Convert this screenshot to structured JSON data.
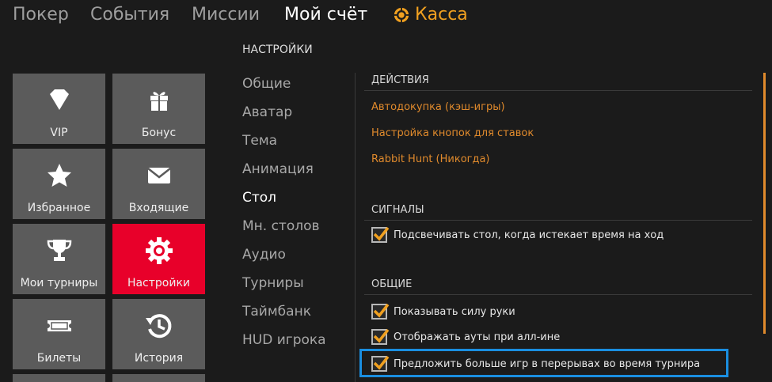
{
  "nav": {
    "items": [
      {
        "label": "Покер",
        "active": false
      },
      {
        "label": "События",
        "active": false
      },
      {
        "label": "Миссии",
        "active": false
      },
      {
        "label": "Мой счёт",
        "active": true
      }
    ],
    "cashier_label": "Касса"
  },
  "tiles": [
    {
      "label": "VIP",
      "icon": "diamond-icon",
      "active": false
    },
    {
      "label": "Бонус",
      "icon": "gift-icon",
      "active": false
    },
    {
      "label": "Избранное",
      "icon": "star-icon",
      "active": false
    },
    {
      "label": "Входящие",
      "icon": "envelope-icon",
      "active": false
    },
    {
      "label": "Мои турниры",
      "icon": "trophy-icon",
      "active": false
    },
    {
      "label": "Настройки",
      "icon": "gear-icon",
      "active": true
    },
    {
      "label": "Билеты",
      "icon": "ticket-icon",
      "active": false
    },
    {
      "label": "История",
      "icon": "history-icon",
      "active": false
    }
  ],
  "settings": {
    "heading": "НАСТРОЙКИ",
    "menu": [
      {
        "label": "Общие",
        "active": false
      },
      {
        "label": "Аватар",
        "active": false
      },
      {
        "label": "Тема",
        "active": false
      },
      {
        "label": "Анимация",
        "active": false
      },
      {
        "label": "Стол",
        "active": true
      },
      {
        "label": "Мн. столов",
        "active": false
      },
      {
        "label": "Аудио",
        "active": false
      },
      {
        "label": "Турниры",
        "active": false
      },
      {
        "label": "Таймбанк",
        "active": false
      },
      {
        "label": "HUD игрока",
        "active": false
      }
    ]
  },
  "content": {
    "actions_title": "ДЕЙСТВИЯ",
    "actions": [
      "Автодокупка (кэш-игры)",
      "Настройка кнопок для ставок",
      "Rabbit Hunt (Никогда)"
    ],
    "signals_title": "СИГНАЛЫ",
    "signals": [
      {
        "label": "Подсвечивать стол, когда истекает время на ход",
        "checked": true
      }
    ],
    "general_title": "ОБЩИЕ",
    "general": [
      {
        "label": "Показывать силу руки",
        "checked": true
      },
      {
        "label": "Отображать ауты при алл-ине",
        "checked": true
      },
      {
        "label": "Предложить больше игр в перерывах во время турнира",
        "checked": true
      }
    ]
  },
  "colors": {
    "accent_orange": "#e08a2c",
    "active_tile_red": "#e8002a",
    "highlight_blue": "#1a8ee0",
    "tile_gray": "#5b5b5b"
  }
}
